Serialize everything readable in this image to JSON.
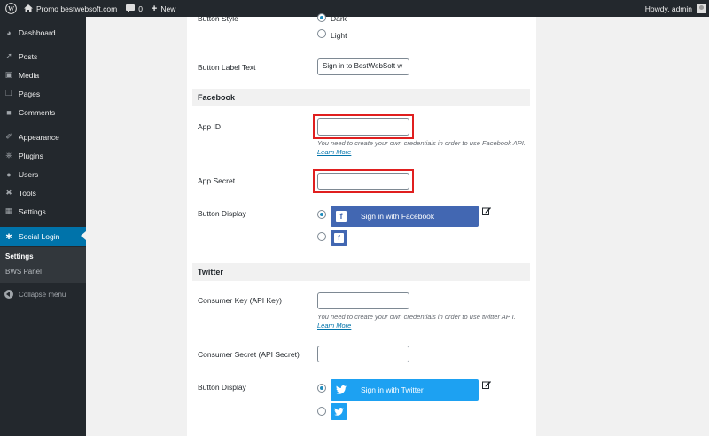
{
  "adminbar": {
    "site_name": "Promo bestwebsoft.com",
    "comments_count": "0",
    "new_label": "New",
    "howdy": "Howdy, admin"
  },
  "sidebar": {
    "items": [
      {
        "label": "Dashboard",
        "icon": "dashboard-icon"
      },
      {
        "label": "Posts",
        "icon": "pin-icon"
      },
      {
        "label": "Media",
        "icon": "media-icon"
      },
      {
        "label": "Pages",
        "icon": "pages-icon"
      },
      {
        "label": "Comments",
        "icon": "comments-icon"
      },
      {
        "label": "Appearance",
        "icon": "appearance-icon"
      },
      {
        "label": "Plugins",
        "icon": "plugins-icon"
      },
      {
        "label": "Users",
        "icon": "users-icon"
      },
      {
        "label": "Tools",
        "icon": "tools-icon"
      },
      {
        "label": "Settings",
        "icon": "settings-icon"
      },
      {
        "label": "Social Login",
        "icon": "social-login-icon"
      }
    ],
    "submenu": [
      "Settings",
      "BWS Panel"
    ],
    "collapse_label": "Collapse menu"
  },
  "form": {
    "button_style_label": "Button Style",
    "style_dark": "Dark",
    "style_light": "Light",
    "button_label_text_label": "Button Label Text",
    "button_label_text_value": "Sign in to BestWebSoft w",
    "facebook": {
      "section_title": "Facebook",
      "app_id_label": "App ID",
      "app_id_value": "",
      "desc_prefix": "You need to create your own credentials in order to use Facebook API.",
      "learn_more": "Learn More",
      "app_secret_label": "App Secret",
      "app_secret_value": "",
      "button_display_label": "Button Display",
      "button_text": "Sign in with Facebook"
    },
    "twitter": {
      "section_title": "Twitter",
      "consumer_key_label": "Consumer Key (API Key)",
      "consumer_key_value": "",
      "desc_prefix": "You need to create your own credentials in order to use twitter AP I.",
      "learn_more": "Learn More",
      "consumer_secret_label": "Consumer Secret (API Secret)",
      "consumer_secret_value": "",
      "button_display_label": "Button Display",
      "button_text": "Sign in with Twitter"
    }
  },
  "colors": {
    "admin_bar": "#23282d",
    "accent": "#0073aa",
    "facebook": "#4267b2",
    "twitter": "#1da1f2",
    "highlight_border": "#e01f1f"
  }
}
